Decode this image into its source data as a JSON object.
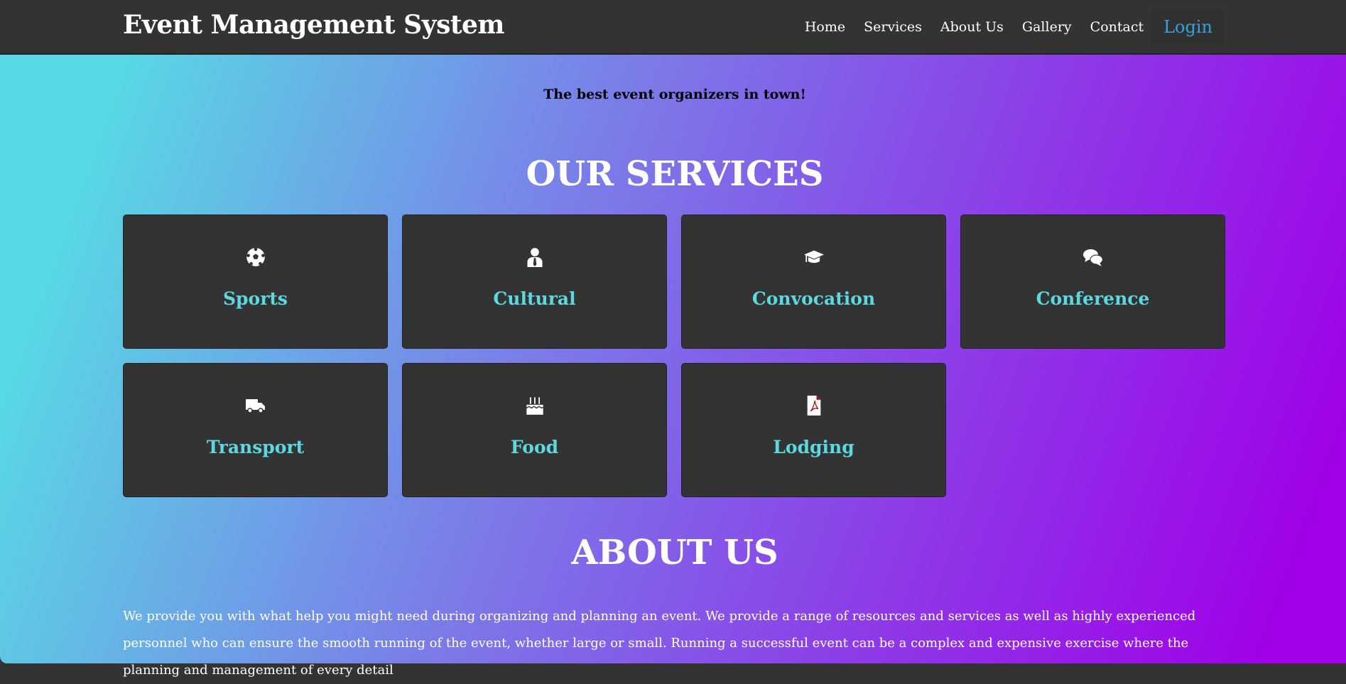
{
  "header": {
    "title": "Event Management System",
    "nav": [
      "Home",
      "Services",
      "About Us",
      "Gallery",
      "Contact"
    ],
    "login": "Login"
  },
  "colors": {
    "header_bg": "#333333",
    "accent": "#5bd8e0",
    "login": "#3aa0e0",
    "gradient_start": "#58d8e4",
    "gradient_end": "#a000e8"
  },
  "tagline": "The best event organizers in town!",
  "services": {
    "title": "OUR SERVICES",
    "items": [
      {
        "label": "Sports",
        "icon": "soccer-ball-icon"
      },
      {
        "label": "Cultural",
        "icon": "user-tie-icon"
      },
      {
        "label": "Convocation",
        "icon": "graduation-cap-icon"
      },
      {
        "label": "Conference",
        "icon": "chat-bubbles-icon"
      },
      {
        "label": "Transport",
        "icon": "truck-icon"
      },
      {
        "label": "Food",
        "icon": "birthday-cake-icon"
      },
      {
        "label": "Lodging",
        "icon": "pdf-file-icon"
      }
    ]
  },
  "about": {
    "title": "ABOUT US",
    "text": "We provide you with what help you might need during organizing and planning an event. We provide a range of resources and services as well as highly experienced personnel who can ensure the smooth running of the event, whether large or small. Running a successful event can be a complex and expensive exercise where the planning and management of every detail"
  }
}
